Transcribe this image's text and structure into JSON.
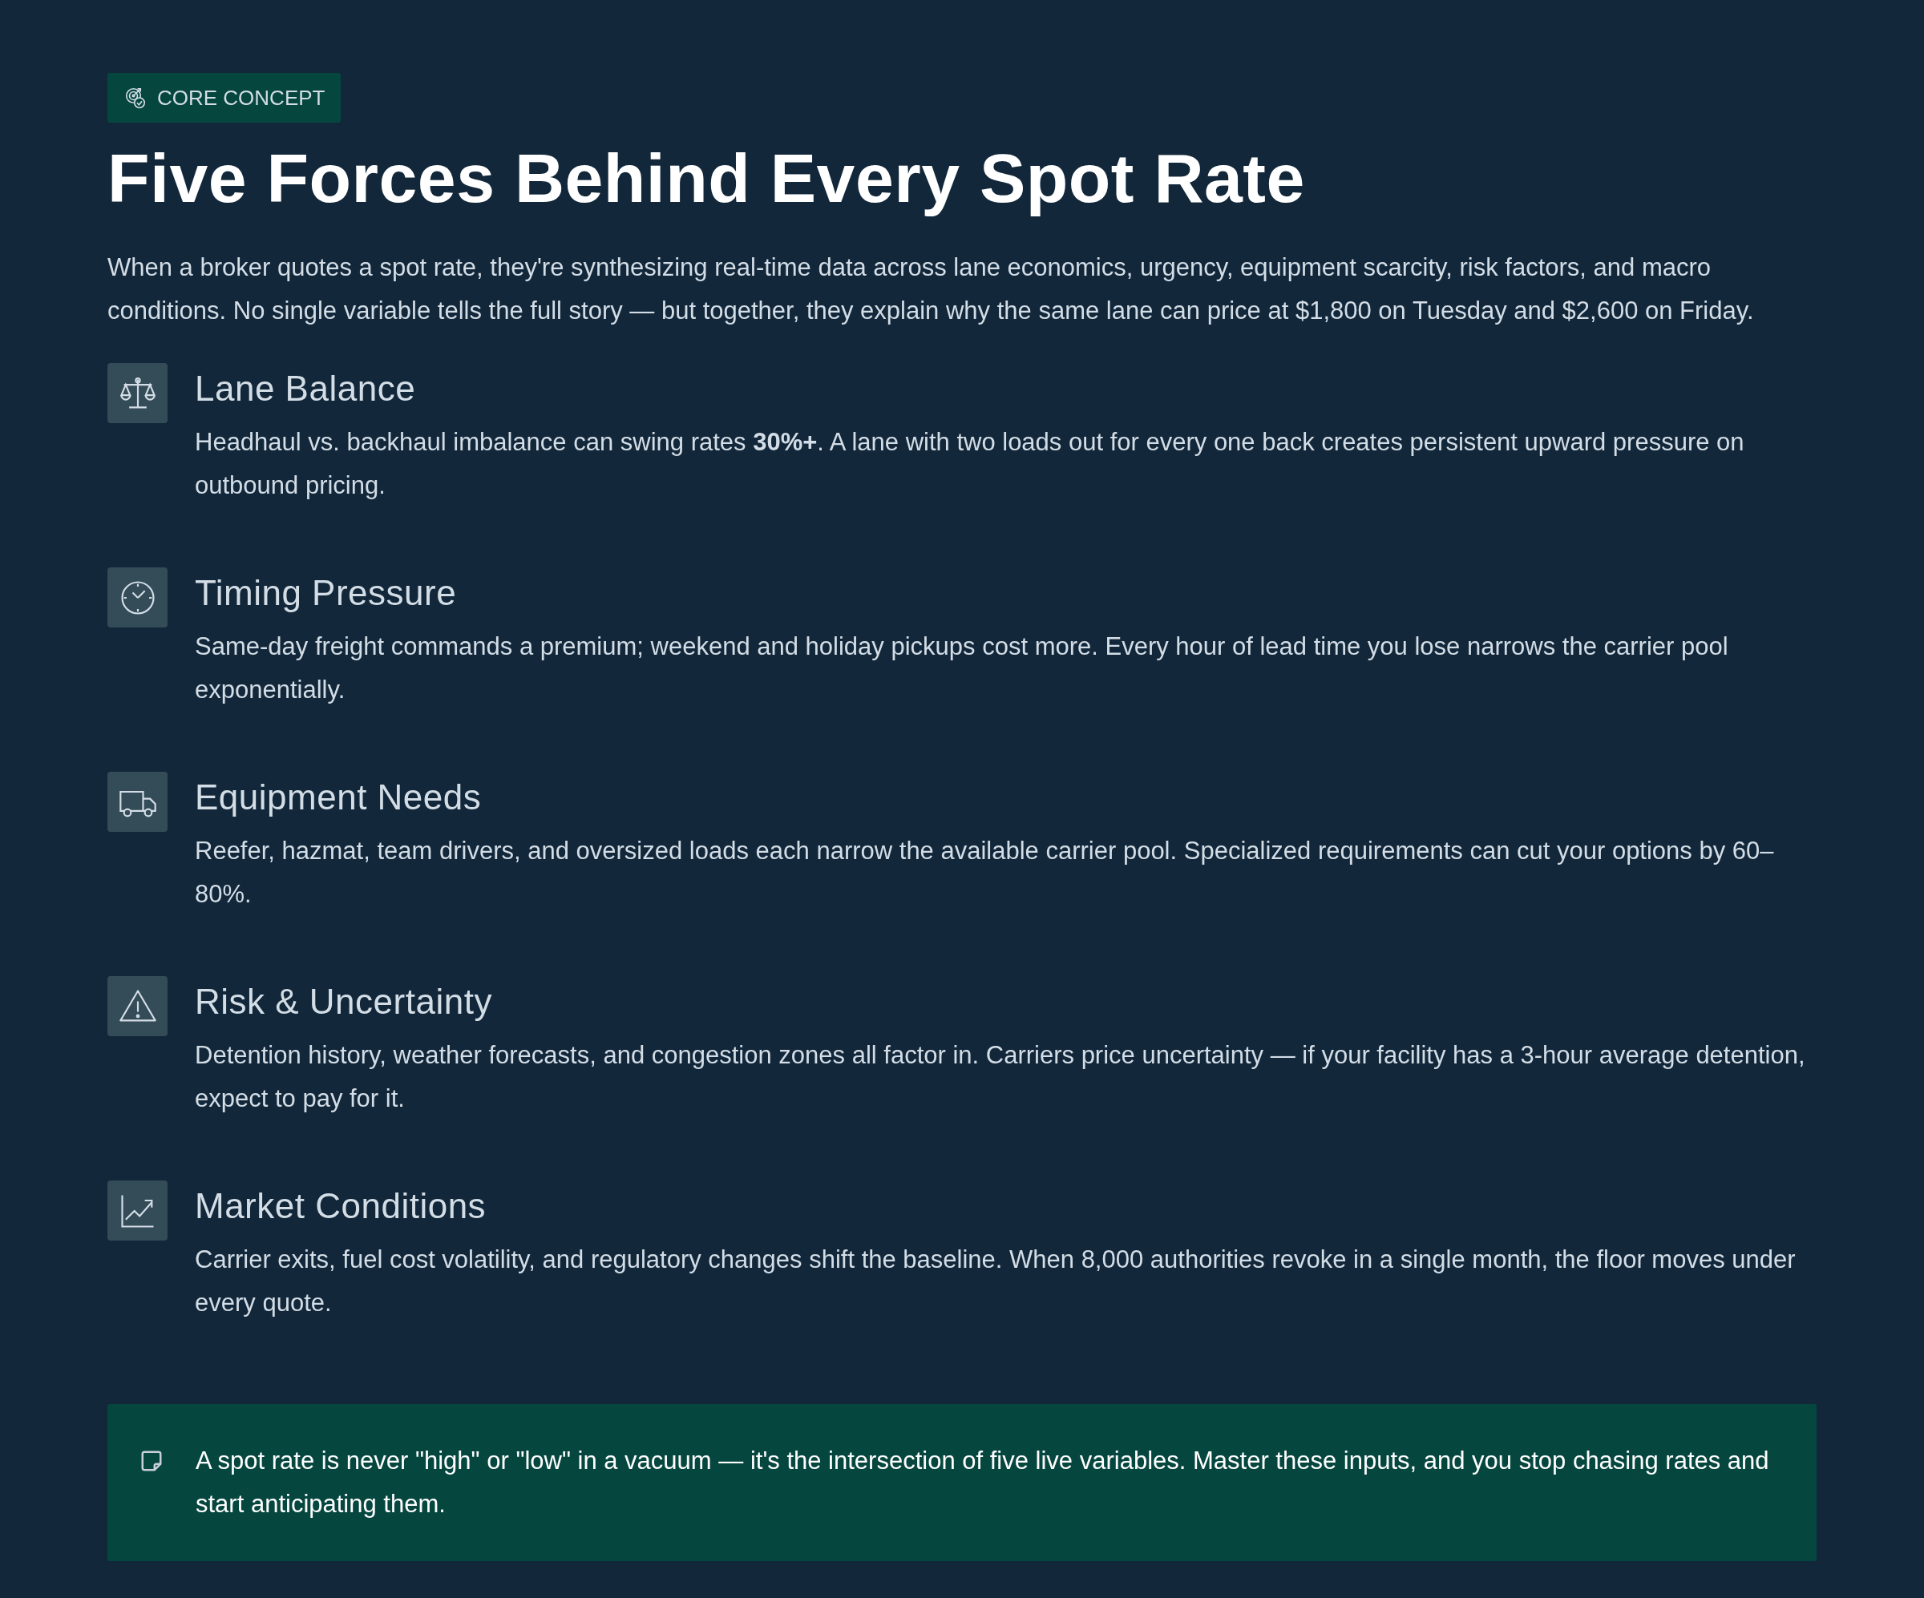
{
  "badge": {
    "label": "CORE CONCEPT"
  },
  "title": "Five Forces Behind Every Spot Rate",
  "intro": "When a broker quotes a spot rate, they're synthesizing real-time data across lane economics, urgency, equipment scarcity, risk factors, and macro conditions. No single variable tells the full story — but together, they explain why the same lane can price at $1,800 on Tuesday and $2,600 on Friday.",
  "forces": [
    {
      "kind": "scale",
      "title": "Lane Balance",
      "text": "Headhaul vs. backhaul imbalance can swing rates **30%+**. A lane with two loads out for every one back creates persistent upward pressure on outbound pricing."
    },
    {
      "kind": "clock",
      "title": "Timing Pressure",
      "text": "Same-day freight commands a premium; weekend and holiday pickups cost more. Every hour of lead time you lose narrows the carrier pool exponentially."
    },
    {
      "kind": "truck",
      "title": "Equipment Needs",
      "text": "Reefer, hazmat, team drivers, and oversized loads each narrow the available carrier pool. Specialized requirements can cut your options by 60–80%."
    },
    {
      "kind": "warning",
      "title": "Risk & Uncertainty",
      "text": "Detention history, weather forecasts, and congestion zones all factor in. Carriers price uncertainty — if your facility has a 3-hour average detention, expect to pay for it."
    },
    {
      "kind": "trend",
      "title": "Market Conditions",
      "text": "Carrier exits, fuel cost volatility, and regulatory changes shift the baseline. When 8,000 authorities revoke in a single month, the floor moves under every quote."
    }
  ],
  "callout": {
    "text": "A spot rate is never \"high\" or \"low\" in a vacuum — it's the intersection of five live variables. Master these inputs, and you stop chasing rates and start anticipating them."
  }
}
